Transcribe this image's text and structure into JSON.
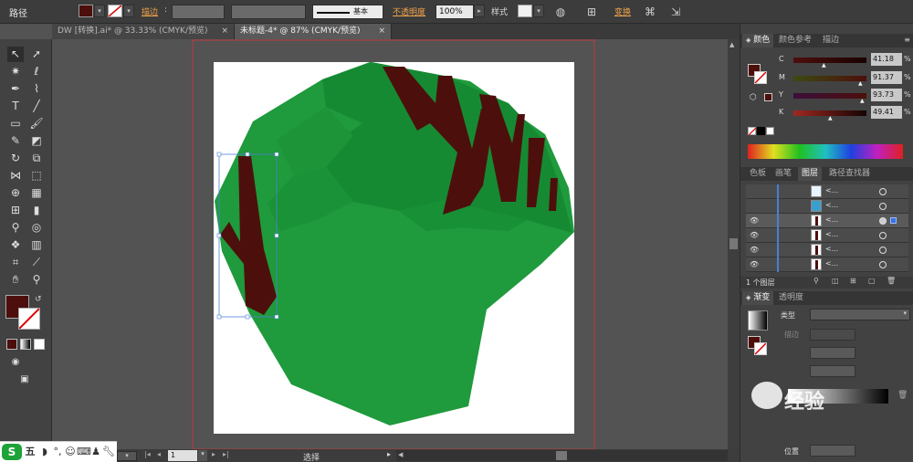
{
  "control_bar": {
    "path_label": "路径",
    "stroke_label": "描边",
    "stroke_style_label": "基本",
    "opacity_label": "不透明度",
    "opacity_value": "100%",
    "style_label": "样式",
    "transform_label": "变换",
    "fill_color": "#4d0f0c"
  },
  "tabs": [
    {
      "label": "DW [转换].ai* @ 33.33% (CMYK/预览)"
    },
    {
      "label": "未标题-4* @ 87% (CMYK/预览)"
    }
  ],
  "color_panel": {
    "tabs": [
      "颜色",
      "颜色参考",
      "描边"
    ],
    "channels": [
      {
        "name": "C",
        "value": "41.18",
        "unit": "%"
      },
      {
        "name": "M",
        "value": "91.37",
        "unit": "%"
      },
      {
        "name": "Y",
        "value": "93.73",
        "unit": "%"
      },
      {
        "name": "K",
        "value": "49.41",
        "unit": "%"
      }
    ]
  },
  "layers_panel": {
    "tabs": [
      "色板",
      "画笔",
      "图层",
      "路径查找器"
    ],
    "rows": [
      {
        "label": "<...",
        "visible": false
      },
      {
        "label": "<...",
        "visible": false
      },
      {
        "label": "<...",
        "visible": true
      },
      {
        "label": "<...",
        "visible": true
      },
      {
        "label": "<...",
        "visible": true
      },
      {
        "label": "<...",
        "visible": true
      }
    ],
    "footer": "1 个图层"
  },
  "gradient_panel": {
    "tabs": [
      "渐变",
      "透明度"
    ],
    "type_label": "类型",
    "stroke_label": "描边",
    "position_label": "位置"
  },
  "status_bar": {
    "zoom": "87%",
    "page": "1",
    "tool": "选择"
  },
  "watermark": "经验",
  "colors": {
    "tree_green": "#1f9a3c",
    "tree_dark_green": "#168a33",
    "trunk": "#4d0f0c",
    "accent": "#f0a24a"
  }
}
